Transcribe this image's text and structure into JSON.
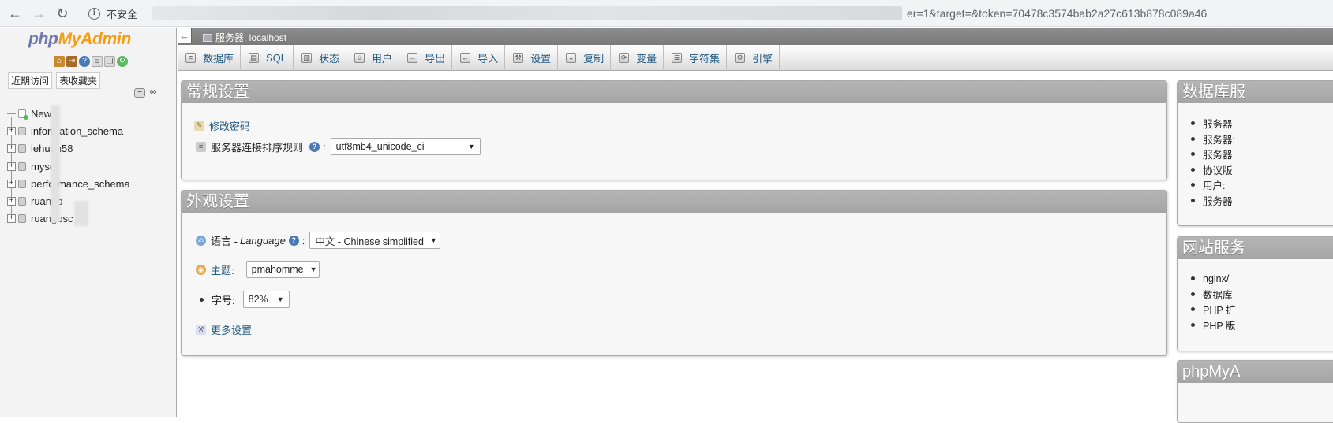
{
  "browser": {
    "back": "←",
    "forward": "→",
    "reload": "↻",
    "insecure_label": "不安全",
    "url_visible": "er=1&target=&token=70478c3574bab2a27c613b878c089a46"
  },
  "nav": {
    "logo_php": "php",
    "logo_myadmin": "MyAdmin",
    "tab_recent": "近期访问",
    "tab_favorites": "表收藏夹",
    "collapse_all": "−",
    "link_toggle": "∞",
    "new_label": "New",
    "databases": [
      {
        "label": "information_schema"
      },
      {
        "label": "lehuan58"
      },
      {
        "label": "mysql"
      },
      {
        "label": "performance_schema"
      },
      {
        "label": "ruangb"
      },
      {
        "label": "ruangbsc"
      }
    ]
  },
  "server_bar": {
    "label": "服务器: localhost",
    "collapse": "←"
  },
  "menu": [
    {
      "label": "数据库",
      "icon": "database-icon"
    },
    {
      "label": "SQL",
      "icon": "sql-icon"
    },
    {
      "label": "状态",
      "icon": "status-icon"
    },
    {
      "label": "用户",
      "icon": "users-icon"
    },
    {
      "label": "导出",
      "icon": "export-icon"
    },
    {
      "label": "导入",
      "icon": "import-icon"
    },
    {
      "label": "设置",
      "icon": "wrench-icon"
    },
    {
      "label": "复制",
      "icon": "replication-icon"
    },
    {
      "label": "变量",
      "icon": "variables-icon"
    },
    {
      "label": "字符集",
      "icon": "charset-icon"
    },
    {
      "label": "引擎",
      "icon": "engine-icon"
    }
  ],
  "general": {
    "title": "常规设置",
    "change_password": "修改密码",
    "collation_label": "服务器连接排序规则",
    "collation_suffix": ":",
    "collation_value": "utf8mb4_unicode_ci"
  },
  "appearance": {
    "title": "外观设置",
    "language_label": "语言 - ",
    "language_italic": "Language",
    "language_suffix": ":",
    "language_value": "中文 - Chinese simplified",
    "theme_label": "主题:",
    "theme_value": "pmahomme",
    "font_label": "字号:",
    "font_value": "82%",
    "more_settings": "更多设置"
  },
  "db_server": {
    "title": "数据库服",
    "items": [
      "服务器",
      "服务器:",
      "服务器",
      "协议版",
      "用户:",
      "服务器"
    ]
  },
  "web_server": {
    "title": "网站服务",
    "items": [
      "nginx/",
      "数据库",
      "PHP 扩",
      "PHP 版"
    ]
  },
  "phpmyadmin_box": {
    "title": "phpMyA"
  }
}
